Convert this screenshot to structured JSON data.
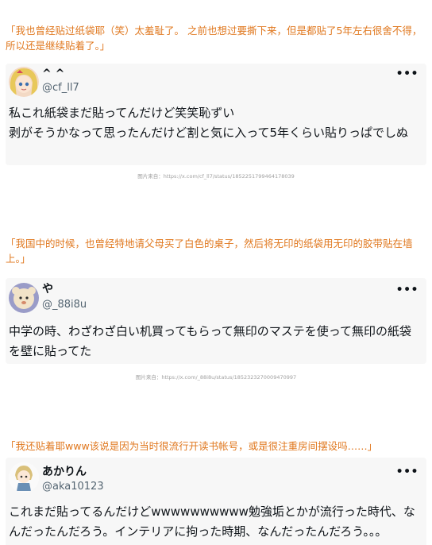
{
  "sections": [
    {
      "quote": "「我也曾经贴过纸袋耶（笑）太羞耻了。 之前也想过要撕下来，但是都贴了5年左右很舍不得，所以还是继续贴着了。」",
      "tweet": {
        "name": "^ ^",
        "handle": "@cf_ll7",
        "text": "私これ紙袋まだ貼ってんだけど笑笑恥ずい\n剥がそうかなって思ったんだけど割と気に入って5年くらい貼りっぱでしぬ",
        "avatar": "anime-girl-avatar"
      },
      "source": "图片来自：https://x.com/cf_ll7/status/1852251799464178039"
    },
    {
      "quote": "「我国中的时候，也曾经特地请父母买了白色的桌子，然后将无印的纸袋用无印的胶带贴在墙上。」",
      "tweet": {
        "name": "や",
        "handle": "@_88i8u",
        "text": "中学の時、わざわざ白い机買ってもらって無印のマステを使って無印の紙袋を壁に貼ってた",
        "avatar": "cartoon-animal-avatar"
      },
      "source": "图片来自：https://x.com/_88i8u/status/1852323270009470997"
    },
    {
      "quote": "「我还贴着耶www该说是因为当时很流行开读书帐号，或是很注重房间摆设吗……」",
      "tweet": {
        "name": "あかりん",
        "handle": "@aka10123",
        "text": "これまだ貼ってるんだけどwwwwwwwwww勉強垢とかが流行った時代、なんだったんだろう。インテリアに拘った時期、なんだったんだろう。。。",
        "avatar": "chibi-character-avatar"
      }
    }
  ],
  "ui": {
    "more_label": "•••"
  },
  "colors": {
    "quote": "#e0781f",
    "card_bg": "#f7f7f7",
    "handle": "#536471",
    "text": "#0f1419"
  }
}
